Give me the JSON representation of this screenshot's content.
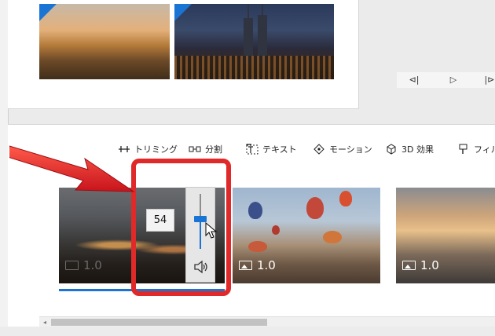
{
  "toolbar": {
    "items": [
      {
        "label": "トリミング",
        "icon": "trim-icon"
      },
      {
        "label": "分割",
        "icon": "split-icon"
      },
      {
        "label": "テキスト",
        "icon": "text-icon"
      },
      {
        "label": "モーション",
        "icon": "motion-icon"
      },
      {
        "label": "3D 効果",
        "icon": "3d-effects-icon"
      },
      {
        "label": "フィル",
        "icon": "filter-icon"
      }
    ]
  },
  "player": {
    "prev": "⊲|",
    "play": "▷",
    "next": "|⊳"
  },
  "storyboard": {
    "clips": [
      {
        "duration": "1.0",
        "media": "video-icon",
        "selected": true
      },
      {
        "duration": "1.0",
        "media": "image-icon",
        "selected": false
      },
      {
        "duration": "1.0",
        "media": "image-icon",
        "selected": false
      }
    ]
  },
  "volume": {
    "value": "54",
    "level": 0.54
  },
  "scrollbar": {
    "left_arrow": "◂"
  },
  "colors": {
    "accent": "#1a74d4",
    "annotation": "#e02a2a"
  }
}
